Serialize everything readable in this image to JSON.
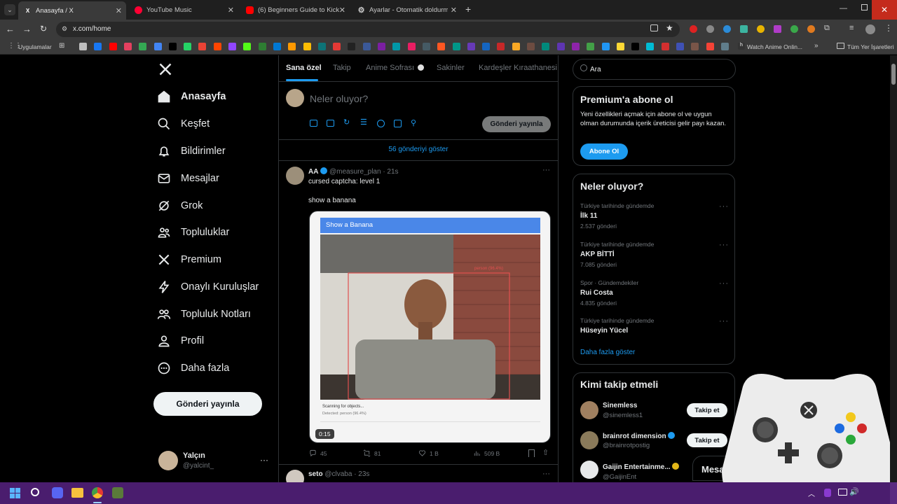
{
  "browser": {
    "tabs": [
      {
        "title": "Anasayfa / X",
        "active": true
      },
      {
        "title": "YouTube Music",
        "active": false
      },
      {
        "title": "(6) Beginners Guide to Kick Stre",
        "active": false
      },
      {
        "title": "Ayarlar - Otomatik doldurma ve",
        "active": false
      }
    ],
    "url": "x.com/home",
    "bookmarks": {
      "apps_label": "Uygulamalar",
      "anime_label": "Watch Anime Onlin...",
      "all_label": "Tüm Yer İşaretleri"
    },
    "colors": {
      "frame": "#1f1f1f",
      "toolbar": "#3a3a3a",
      "taskbar": "#4a1d6e"
    }
  },
  "sidebar": {
    "items": [
      {
        "label": "Anasayfa",
        "icon": "home-icon"
      },
      {
        "label": "Keşfet",
        "icon": "search-icon"
      },
      {
        "label": "Bildirimler",
        "icon": "bell-icon"
      },
      {
        "label": "Mesajlar",
        "icon": "mail-icon"
      },
      {
        "label": "Grok",
        "icon": "grok-icon"
      },
      {
        "label": "Topluluklar",
        "icon": "communities-icon"
      },
      {
        "label": "Premium",
        "icon": "x-logo-icon"
      },
      {
        "label": "Onaylı Kuruluşlar",
        "icon": "lightning-icon"
      },
      {
        "label": "Topluluk Notları",
        "icon": "notes-icon"
      },
      {
        "label": "Profil",
        "icon": "person-icon"
      },
      {
        "label": "Daha fazla",
        "icon": "more-circle-icon"
      }
    ],
    "post_button": "Gönderi yayınla",
    "user": {
      "name": "Yalçın",
      "handle": "@yalcint_"
    }
  },
  "feed": {
    "tabs": [
      "Sana özel",
      "Takip",
      "Anime Sofrası",
      "Sakinler",
      "Kardeşler Kıraathanesi"
    ],
    "composer_placeholder": "Neler oluyor?",
    "composer_button": "Gönderi yayınla",
    "show_posts": "56 gönderiyi göster",
    "post": {
      "name": "AA",
      "handle": "@measure_plan",
      "time": "· 21s",
      "text1": "cursed captcha: level 1",
      "text2": "show a banana",
      "media_title": "Show a Banana",
      "detect_label": "person (96.4%)",
      "scanning": "Scanning for objects...",
      "detected": "Detected: person (96.4%)",
      "duration": "0:15",
      "replies": "45",
      "reposts": "81",
      "likes": "1 B",
      "views": "509 B"
    },
    "next_post": {
      "name": "seto",
      "handle": "@clvaba",
      "time": "· 23s"
    }
  },
  "right": {
    "search_placeholder": "Ara",
    "premium": {
      "title": "Premium'a abone ol",
      "text": "Yeni özellikleri açmak için abone ol ve uygun olman durumunda içerik üreticisi gelir payı kazan.",
      "button": "Abone Ol"
    },
    "trends": {
      "title": "Neler oluyor?",
      "items": [
        {
          "meta": "Türkiye tarihinde gündemde",
          "name": "İlk 11",
          "count": "2.537 gönderi"
        },
        {
          "meta": "Türkiye tarihinde gündemde",
          "name": "AKP BİTTİ",
          "count": "7.085 gönderi"
        },
        {
          "meta": "Spor · Gündemdekiler",
          "name": "Rui Costa",
          "count": "4.835 gönderi"
        },
        {
          "meta": "Türkiye tarihinde gündemde",
          "name": "Hüseyin Yücel",
          "count": ""
        }
      ],
      "more": "Daha fazla göster"
    },
    "who_to_follow": {
      "title": "Kimi takip etmeli",
      "users": [
        {
          "name": "Sinemless",
          "handle": "@sinemless1",
          "verified": false
        },
        {
          "name": "brainrot dimension",
          "handle": "@brainrotpostig",
          "verified": true
        },
        {
          "name": "Gaijin Entertainme...",
          "handle": "@GaijinEnt",
          "verified": true
        }
      ],
      "button": "Takip et"
    },
    "messages_label": "Mesa"
  },
  "accent": "#1d9bf0"
}
